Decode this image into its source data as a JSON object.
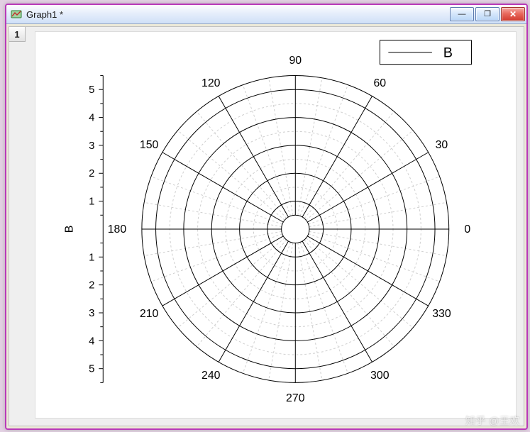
{
  "window": {
    "title": "Graph1 *",
    "row_label": "1",
    "buttons": {
      "min": "—",
      "max": "❐",
      "close": "✕"
    }
  },
  "watermark": "知乎 @王欢",
  "chart_data": {
    "type": "polar-grid",
    "legend": {
      "label": "B",
      "position": "top-right"
    },
    "axis_title": "B",
    "series": [],
    "angles_deg": [
      0,
      30,
      60,
      90,
      120,
      150,
      180,
      210,
      240,
      270,
      300,
      330
    ],
    "radial_major": [
      1,
      2,
      3,
      4,
      5
    ],
    "radial_ticks_upper": [
      1,
      2,
      3,
      4,
      5
    ],
    "radial_ticks_lower": [
      1,
      2,
      3,
      4,
      5
    ],
    "r_range": [
      0.5,
      5.5
    ],
    "r_axis_numbered_top": [
      1,
      2,
      3,
      4,
      5
    ],
    "r_axis_numbered_bottom": [
      1,
      2,
      3,
      4,
      5
    ]
  }
}
